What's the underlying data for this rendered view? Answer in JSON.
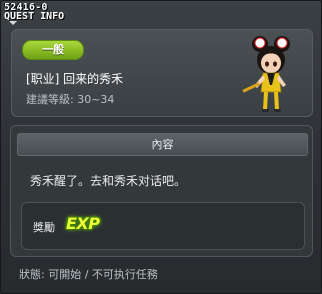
{
  "window": {
    "quest_id": "52416-0",
    "title": "QUEST INFO"
  },
  "quest": {
    "category": "一般",
    "title": "[职业] 回来的秀禾",
    "level_range": "建議等級: 30~34"
  },
  "content": {
    "header": "內容",
    "description": "秀禾醒了。去和秀禾对话吧。"
  },
  "reward": {
    "label": "獎勵",
    "item": "EXP"
  },
  "status": "狀態: 可開始 / 不可执行任務",
  "colors": {
    "badge_green": "#8cc327",
    "exp_yellow": "#eaff3a",
    "exp_outline": "#3e7a00"
  },
  "icons": {
    "npc": "npc-character-portrait",
    "close": "close-icon",
    "dropdown": "chevron-down-icon"
  }
}
